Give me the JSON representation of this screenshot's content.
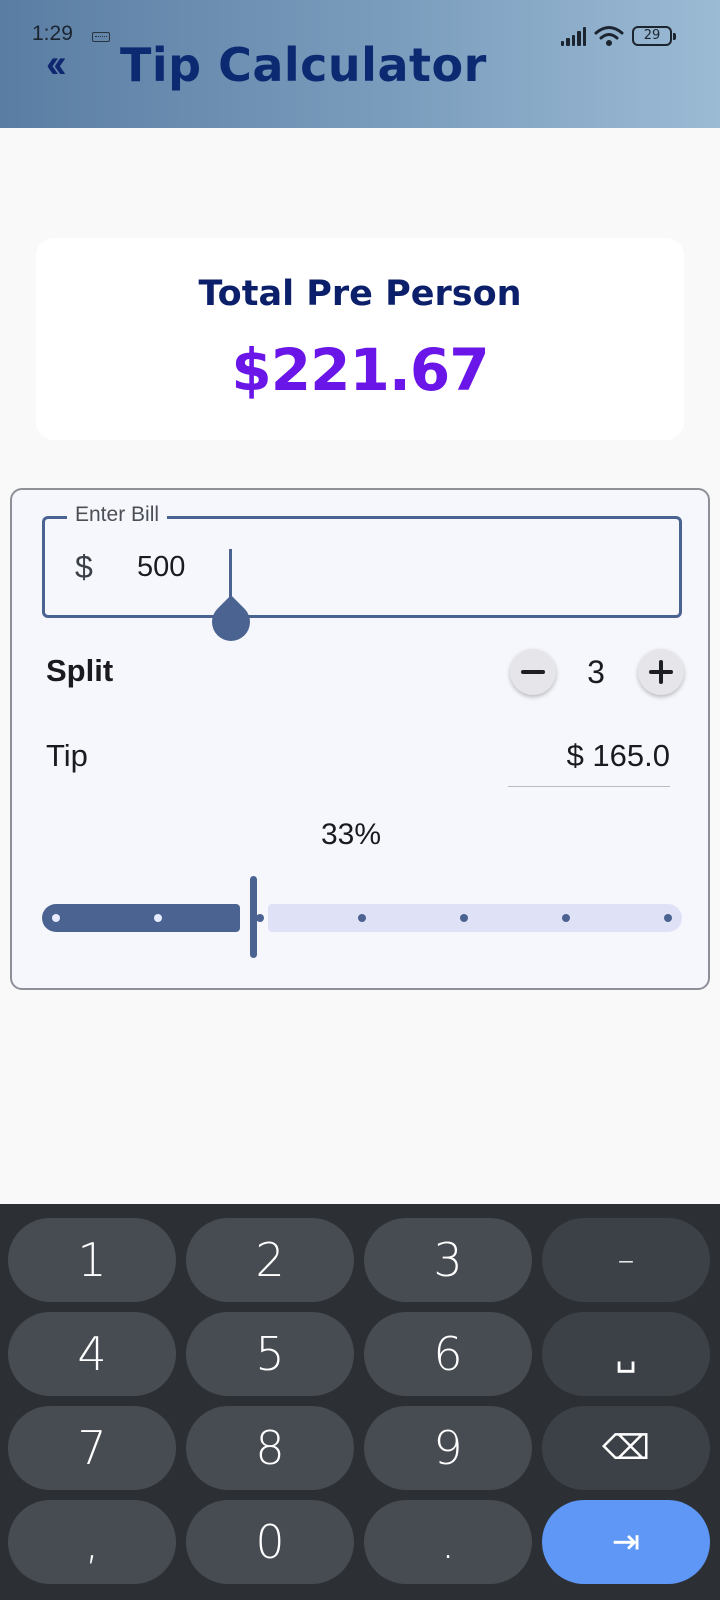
{
  "status_bar": {
    "time": "1:29",
    "battery": "29"
  },
  "header": {
    "back_icon": "double-chevron-left-icon",
    "title": "Tip Calculator"
  },
  "total_card": {
    "label": "Total Pre Person",
    "amount": "$221.67",
    "amount_color": "#6a16e8"
  },
  "bill_field": {
    "label": "Enter Bill",
    "prefix": "$",
    "value": "500"
  },
  "split": {
    "label": "Split",
    "value": "3",
    "minus_icon": "minus-icon",
    "plus_icon": "plus-icon"
  },
  "tip": {
    "label": "Tip",
    "value": "$ 165.0",
    "percent_text": "33%",
    "slider": {
      "min": 0,
      "max": 100,
      "value": 33,
      "steps": 6,
      "active_color": "#4b6391",
      "inactive_color": "#dfe2f7"
    }
  },
  "keyboard": {
    "rows": [
      [
        "1",
        "2",
        "3",
        "–"
      ],
      [
        "4",
        "5",
        "6",
        "␣"
      ],
      [
        "7",
        "8",
        "9",
        "⌫"
      ],
      [
        ",",
        "0",
        ".",
        "⇥"
      ]
    ],
    "special_keys": {
      "dash": "dash-icon",
      "space": "space-icon",
      "backspace": "backspace-icon",
      "next": "next-field-icon"
    },
    "accent_color": "#5e97f6"
  }
}
